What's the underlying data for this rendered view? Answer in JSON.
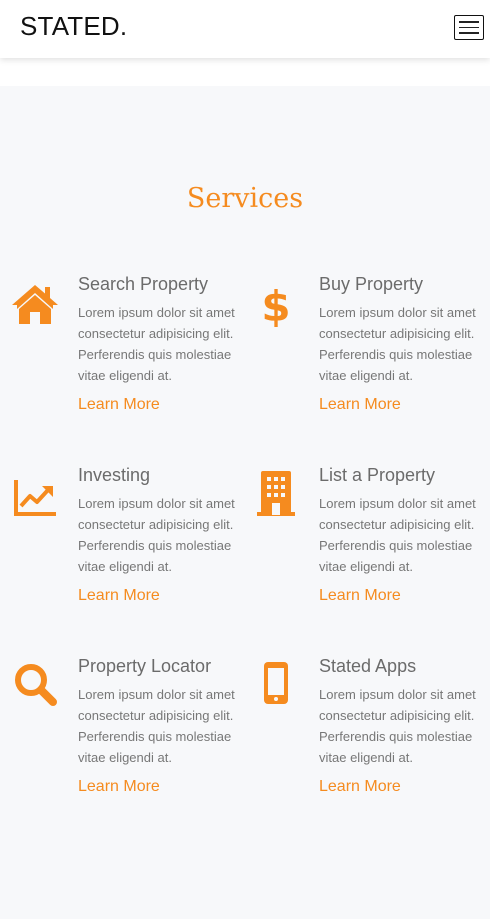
{
  "navbar": {
    "brand": "STATED."
  },
  "services": {
    "title": "Services",
    "accent_color": "#f58b1f",
    "items": [
      {
        "icon": "home-icon",
        "title": "Search Property",
        "text": "Lorem ipsum dolor sit amet consectetur adipisicing elit. Perferendis quis molestiae vitae eligendi at.",
        "link": "Learn More"
      },
      {
        "icon": "dollar-icon",
        "title": "Buy Property",
        "text": "Lorem ipsum dolor sit amet consectetur adipisicing elit. Perferendis quis molestiae vitae eligendi at.",
        "link": "Learn More"
      },
      {
        "icon": "chart-line-icon",
        "title": "Investing",
        "text": "Lorem ipsum dolor sit amet consectetur adipisicing elit. Perferendis quis molestiae vitae eligendi at.",
        "link": "Learn More"
      },
      {
        "icon": "building-icon",
        "title": "List a Property",
        "text": "Lorem ipsum dolor sit amet consectetur adipisicing elit. Perferendis quis molestiae vitae eligendi at.",
        "link": "Learn More"
      },
      {
        "icon": "search-icon",
        "title": "Property Locator",
        "text": "Lorem ipsum dolor sit amet consectetur adipisicing elit. Perferendis quis molestiae vitae eligendi at.",
        "link": "Learn More"
      },
      {
        "icon": "mobile-phone-icon",
        "title": "Stated Apps",
        "text": "Lorem ipsum dolor sit amet consectetur adipisicing elit. Perferendis quis molestiae vitae eligendi at.",
        "link": "Learn More"
      }
    ]
  }
}
